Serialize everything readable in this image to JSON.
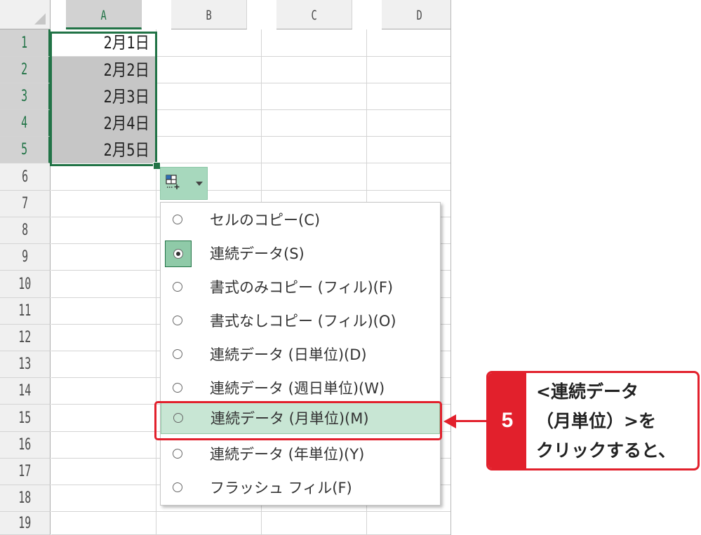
{
  "sheet": {
    "columns": [
      "A",
      "B",
      "C",
      "D"
    ],
    "rows": [
      "1",
      "2",
      "3",
      "4",
      "5",
      "6",
      "7",
      "8",
      "9",
      "10",
      "11",
      "12",
      "13",
      "14",
      "15",
      "16",
      "17",
      "18",
      "19"
    ],
    "cells": [
      "2月1日",
      "2月2日",
      "2月3日",
      "2月4日",
      "2月5日"
    ]
  },
  "autofill": {
    "icon": "auto-fill-options-icon",
    "arrow_icon": "dropdown-arrow-icon"
  },
  "menu": {
    "items": [
      {
        "label": "セルのコピー(C)",
        "selected": false
      },
      {
        "label": "連続データ(S)",
        "selected": true
      },
      {
        "label": "書式のみコピー (フィル)(F)",
        "selected": false
      },
      {
        "label": "書式なしコピー (フィル)(O)",
        "selected": false
      },
      {
        "label": "連続データ (日単位)(D)",
        "selected": false
      },
      {
        "label": "連続データ (週日単位)(W)",
        "selected": false
      },
      {
        "label": "連続データ (月単位)(M)",
        "selected": false,
        "highlighted": true
      },
      {
        "label": "連続データ (年単位)(Y)",
        "selected": false
      },
      {
        "label": "フラッシュ フィル(F)",
        "selected": false
      }
    ]
  },
  "callout": {
    "step": "5",
    "lines": [
      "<連続データ",
      "（月単位）>を",
      "クリックすると、"
    ],
    "color": "#e2202c"
  }
}
